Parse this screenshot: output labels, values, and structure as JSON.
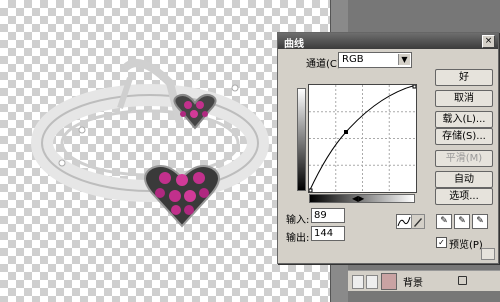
{
  "dialog": {
    "title": "曲线",
    "close_glyph": "×",
    "channel_label": "通道(C):",
    "channel_value": "RGB",
    "input_label": "输入:",
    "input_value": "89",
    "output_label": "输出:",
    "output_value": "144",
    "buttons": {
      "ok": "好",
      "cancel": "取消",
      "load": "载入(L)...",
      "save": "存储(S)...",
      "smooth": "平滑(M)",
      "auto": "自动",
      "options": "选项..."
    },
    "preview_label": "预览(P)",
    "preview_checked": true,
    "curve_point": {
      "input": 89,
      "output": 144
    }
  },
  "layers": {
    "layer_name": "背景"
  },
  "colors": {
    "dialog_bg": "#d4d0c8",
    "titlebar": "#3b3b3b"
  }
}
